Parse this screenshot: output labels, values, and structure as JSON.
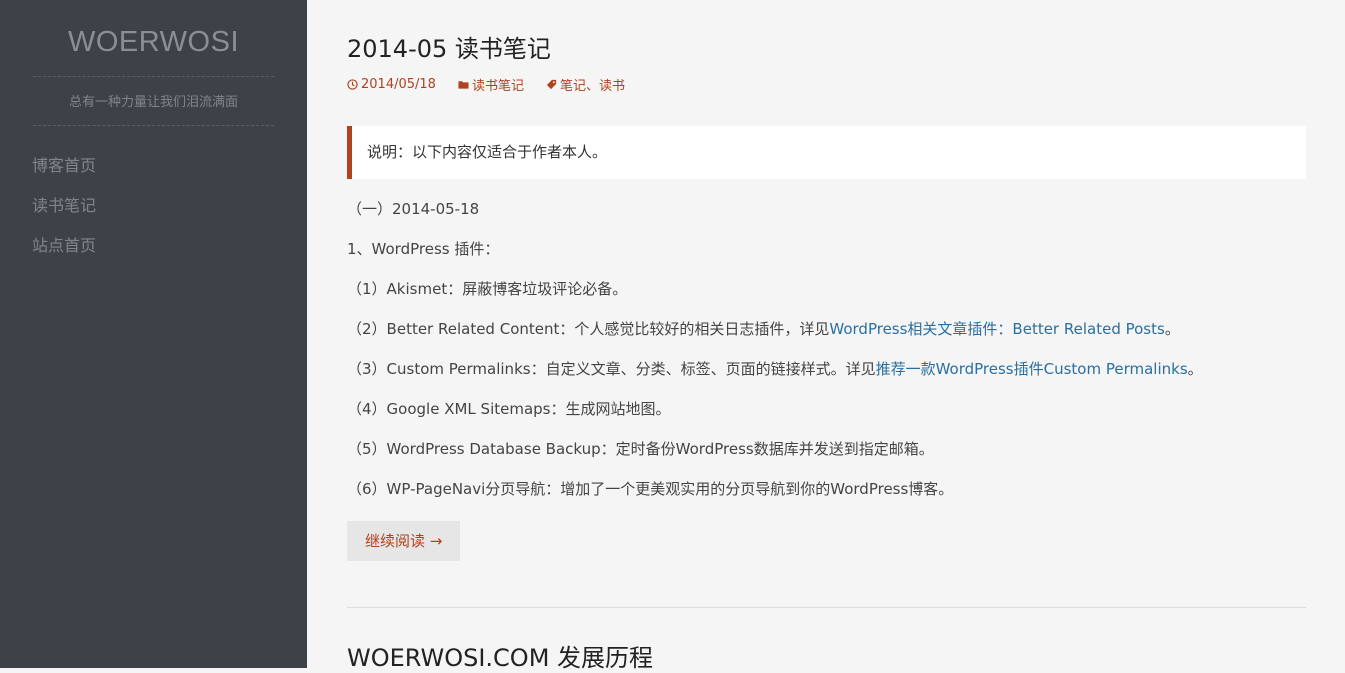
{
  "site": {
    "title": "WOERWOSI",
    "tagline": "总有一种力量让我们泪流满面"
  },
  "nav": [
    {
      "label": "博客首页"
    },
    {
      "label": "读书笔记"
    },
    {
      "label": "站点首页"
    }
  ],
  "post": {
    "title": "2014-05 读书笔记",
    "date": "2014/05/18",
    "category": "读书笔记",
    "tags": "笔记、读书",
    "notice": "说明：以下内容仅适合于作者本人。",
    "lines": {
      "l1": "（一）2014-05-18",
      "l2": "1、WordPress 插件：",
      "l3": "（1）Akismet：屏蔽博客垃圾评论必备。",
      "l4_pre": "（2）Better Related Content：个人感觉比较好的相关日志插件，详见",
      "l4_link": "WordPress相关文章插件：Better Related Posts",
      "l4_post": "。",
      "l5_pre": "（3）Custom Permalinks：自定义文章、分类、标签、页面的链接样式。详见",
      "l5_link": "推荐一款WordPress插件Custom Permalinks",
      "l5_post": "。",
      "l6": "（4）Google XML Sitemaps：生成网站地图。",
      "l7": "（5）WordPress Database Backup：定时备份WordPress数据库并发送到指定邮箱。",
      "l8": "（6）WP-PageNavi分页导航：增加了一个更美观实用的分页导航到你的WordPress博客。"
    },
    "read_more": "继续阅读 →"
  },
  "next_post": {
    "title": "WOERWOSI.COM 发展历程"
  },
  "colors": {
    "sidebar_bg": "#3d4249",
    "accent": "#b0421d",
    "link": "#2a6fa0"
  }
}
